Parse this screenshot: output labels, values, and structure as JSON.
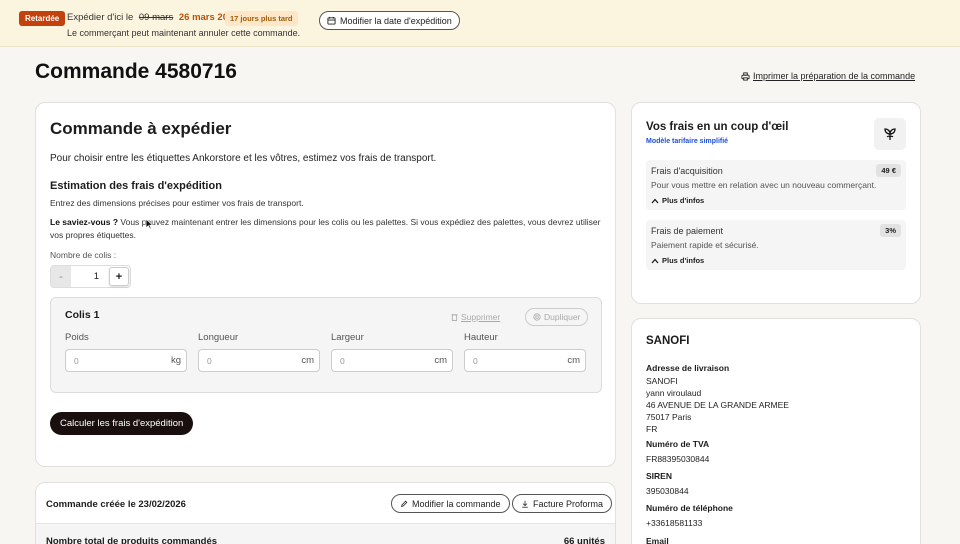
{
  "banner": {
    "badge": "Retardée",
    "ship_prefix": "Expédier d'ici le",
    "old_date": "09 mars",
    "new_date": "26 mars 2026",
    "late_pill": "17 jours plus tard",
    "modify_button": "Modifier la date d'expédition",
    "cancel_note": "Le commerçant peut maintenant annuler cette commande.",
    "colors": {
      "badge": "#c2410c",
      "new_date": "#b45309",
      "background": "#fbf5df"
    }
  },
  "header": {
    "title": "Commande 4580716",
    "print_link": "Imprimer la préparation de la commande"
  },
  "shipping": {
    "title": "Commande à expédier",
    "intro": "Pour choisir entre les étiquettes Ankorstore et les vôtres, estimez vos frais de transport.",
    "estimation_title": "Estimation des frais d'expédition",
    "estimation_desc": "Entrez des dimensions précises pour estimer vos frais de transport.",
    "tip_bold": "Le saviez-vous ?",
    "tip_text": " Vous pouvez maintenant entrer les dimensions pour les colis ou les palettes. Si vous expédiez des palettes, vous devrez utiliser vos propres étiquettes.",
    "parcels_label": "Nombre de colis :",
    "parcels_minus": "-",
    "parcels_value": "1",
    "parcels_plus": "+",
    "colis": {
      "title": "Colis 1",
      "delete": "Supprimer",
      "duplicate": "Dupliquer",
      "fields": [
        {
          "label": "Poids",
          "placeholder": "0",
          "unit": "kg"
        },
        {
          "label": "Longueur",
          "placeholder": "0",
          "unit": "cm"
        },
        {
          "label": "Largeur",
          "placeholder": "0",
          "unit": "cm"
        },
        {
          "label": "Hauteur",
          "placeholder": "0",
          "unit": "cm"
        }
      ]
    },
    "calculate_button": "Calculer les frais d'expédition"
  },
  "order": {
    "created": "Commande créée le 23/02/2026",
    "edit_button": "Modifier la commande",
    "invoice_button": "Facture Proforma",
    "total_label": "Nombre total de produits commandés",
    "total_value": "66 unités"
  },
  "fees": {
    "title": "Vos frais en un coup d'œil",
    "subtitle": "Modèle tarifaire simplifié",
    "items": [
      {
        "name": "Frais d'acquisition",
        "value": "49 €",
        "desc": "Pour vous mettre en relation avec un nouveau commerçant.",
        "more": "Plus d'infos"
      },
      {
        "name": "Frais de paiement",
        "value": "3%",
        "desc": "Paiement rapide et sécurisé.",
        "more": "Plus d'infos"
      }
    ]
  },
  "customer": {
    "name": "SANOFI",
    "address_label": "Adresse de livraison",
    "address_lines": [
      "SANOFI",
      "yann viroulaud",
      "46 AVENUE DE LA GRANDE ARMEE",
      "75017 Paris",
      "FR"
    ],
    "vat_label": "Numéro de TVA",
    "vat": "FR88395030844",
    "siren_label": "SIREN",
    "siren": "395030844",
    "phone_label": "Numéro de téléphone",
    "phone": "+33618581133",
    "email_label": "Email"
  }
}
